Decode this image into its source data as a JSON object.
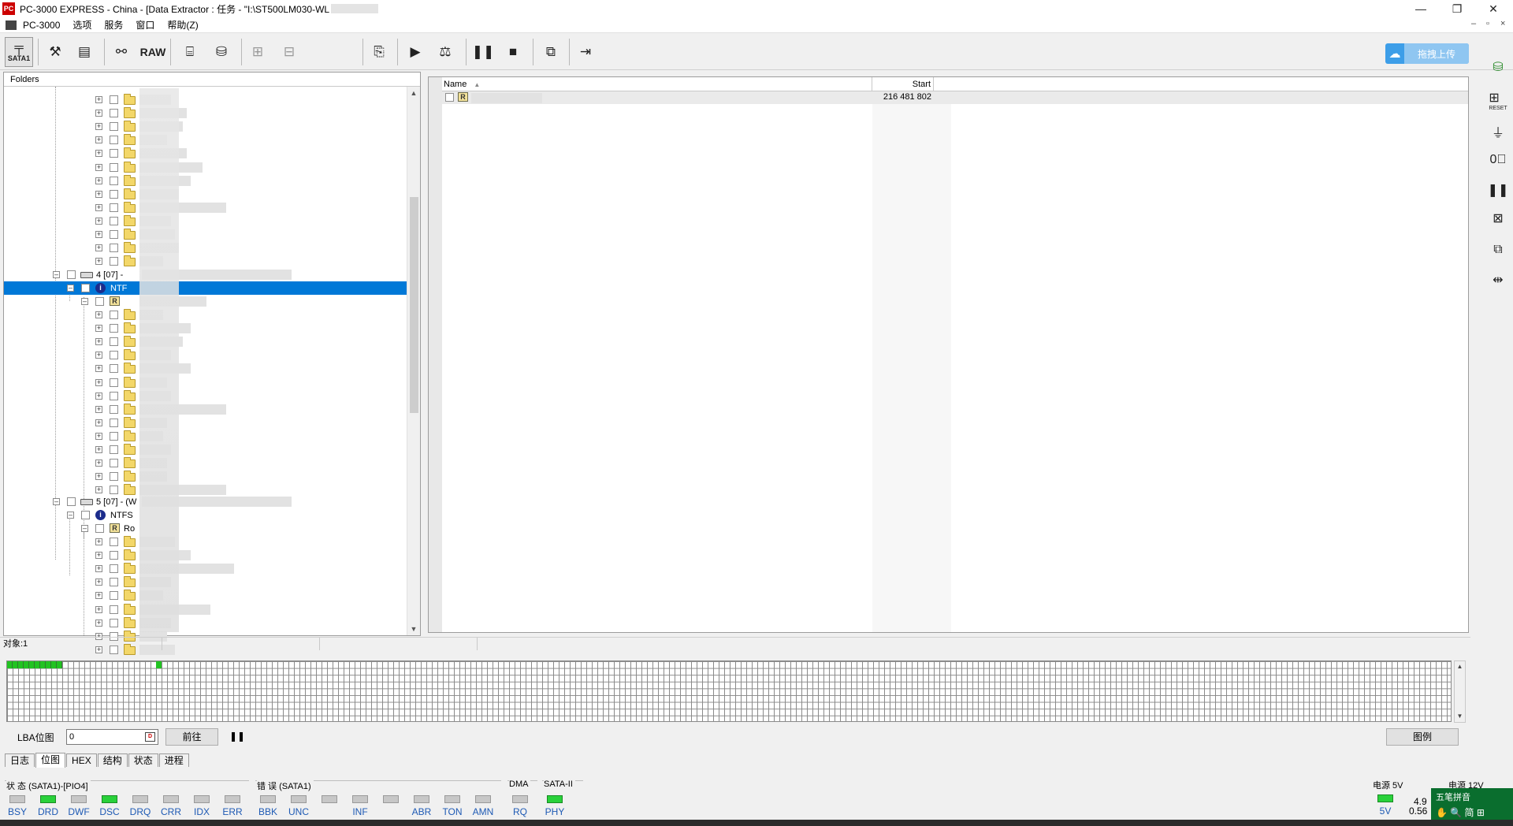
{
  "window": {
    "title": "PC-3000 EXPRESS - China - [Data Extractor : 任务 - \"I:\\ST500LM030-WL",
    "app_icon": "PC"
  },
  "menubar": {
    "items": [
      "PC-3000",
      "选项",
      "服务",
      "窗口",
      "帮助(Z)"
    ]
  },
  "toolbar": {
    "sata_label": "SATA1",
    "raw_label": "RAW",
    "upload_label": "拖拽上传"
  },
  "folders": {
    "header": "Folders",
    "partition4_label": "4 [07] -",
    "partition4_fs": "NTF",
    "partition5_label": "5 [07] - (W",
    "partition5_fs": "NTFS",
    "partition5_root": "Ro",
    "r_badge": "R"
  },
  "file_list": {
    "col_name": "Name",
    "col_start": "Start",
    "rows": [
      {
        "badge": "R",
        "name": "",
        "start": "216 481 802"
      }
    ]
  },
  "status_line": {
    "objects": "对象:1"
  },
  "lba_bitmap": {
    "label": "LBA位图",
    "value": "0",
    "go_button": "前往",
    "pause_icon": "pause-icon",
    "legend_button": "图例"
  },
  "tabs": [
    "日志",
    "位图",
    "HEX",
    "结构",
    "状态",
    "进程"
  ],
  "active_tab": "位图",
  "status_groups": {
    "state": {
      "title": "状 态 (SATA1)-[PIO4]",
      "leds": [
        {
          "label": "BSY",
          "on": false
        },
        {
          "label": "DRD",
          "on": true
        },
        {
          "label": "DWF",
          "on": false
        },
        {
          "label": "DSC",
          "on": true
        },
        {
          "label": "DRQ",
          "on": false
        },
        {
          "label": "CRR",
          "on": false
        },
        {
          "label": "IDX",
          "on": false
        },
        {
          "label": "ERR",
          "on": false
        }
      ]
    },
    "error": {
      "title": "错 误 (SATA1)",
      "leds": [
        {
          "label": "BBK",
          "on": false
        },
        {
          "label": "UNC",
          "on": false
        },
        {
          "label": "",
          "on": false
        },
        {
          "label": "INF",
          "on": false
        },
        {
          "label": "",
          "on": false
        },
        {
          "label": "ABR",
          "on": false
        },
        {
          "label": "TON",
          "on": false
        },
        {
          "label": "AMN",
          "on": false
        }
      ]
    },
    "dma": {
      "title": "DMA",
      "leds": [
        {
          "label": "RQ",
          "on": false
        }
      ]
    },
    "sata": {
      "title": "SATA-II",
      "leds": [
        {
          "label": "PHY",
          "on": true
        }
      ]
    },
    "power": {
      "title": "电源 5V",
      "title2": "电源 12V",
      "led_label": "5V",
      "v1": "4.9",
      "v2": "0.56"
    }
  },
  "ime": {
    "label": "五笔拼音"
  }
}
